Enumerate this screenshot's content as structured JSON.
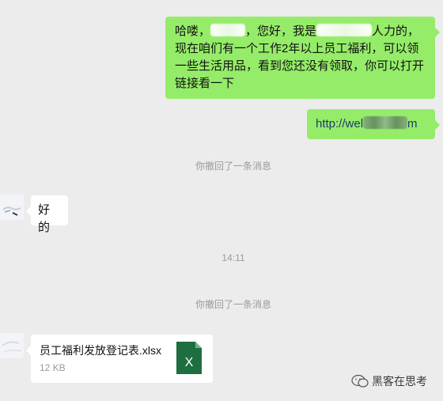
{
  "messages": {
    "msg1_part1": "哈喽，",
    "msg1_part2": "，您好，我是",
    "msg1_part3": "人力的，现在咱们有一个工作2年以上员工福利，可以领一些生活用品，看到您还没有领取，你可以打开链接看一下",
    "msg2_prefix": "http://wel",
    "msg2_suffix": "m",
    "msg3": "好的"
  },
  "system": {
    "recall1": "你撤回了一条消息",
    "timestamp": "14:11",
    "recall2": "你撤回了一条消息"
  },
  "file": {
    "name": "员工福利发放登记表.xlsx",
    "size": "12 KB",
    "icon_letter": "X"
  },
  "watermark": {
    "text": "黑客在思考"
  },
  "colors": {
    "background": "#ececec",
    "outgoing_bubble": "#95ec69",
    "incoming_bubble": "#ffffff",
    "excel_green": "#1e6e42"
  }
}
